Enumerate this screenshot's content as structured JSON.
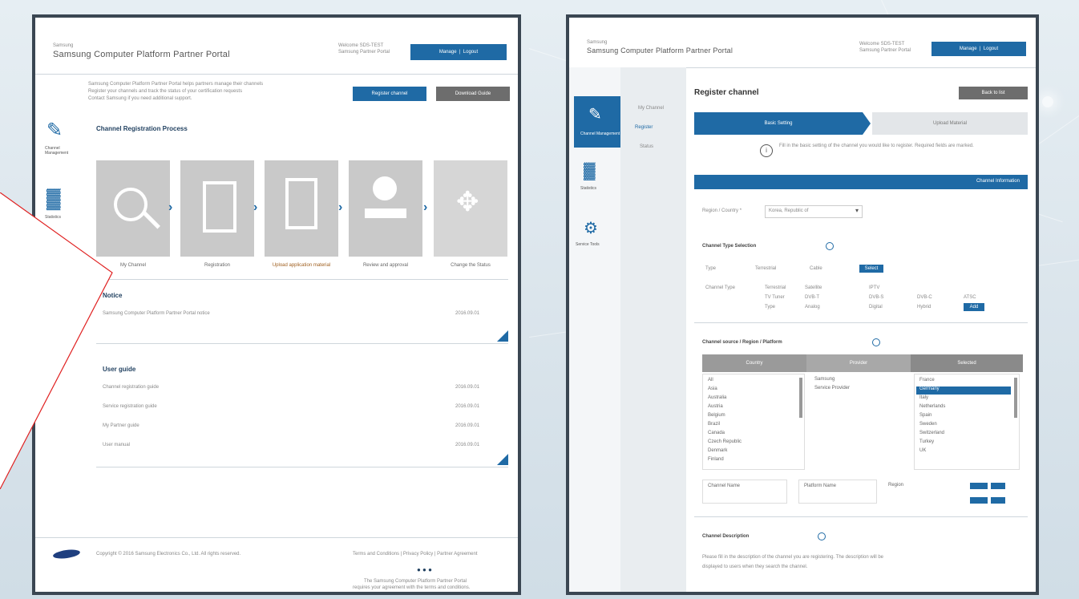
{
  "left_page": {
    "brand_small": "Samsung",
    "title": "Samsung Computer Platform Partner Portal",
    "user_line1": "Welcome SDS-TEST",
    "user_line2": "Samsung Partner Portal",
    "login_label": "Manage",
    "logout_label": "Logout",
    "intro_lines": [
      "Samsung Computer Platform Partner Portal helps partners manage their channels",
      "Register your channels and track the status of your certification requests",
      "Contact Samsung if you need additional support."
    ],
    "register_button": "Register channel",
    "download_button": "Download Guide",
    "side_items": [
      {
        "icon": "register-icon",
        "label": "Channel Management"
      },
      {
        "icon": "chart-icon",
        "label": "Statistics"
      }
    ],
    "process_heading": "Channel Registration Process",
    "process_steps": [
      {
        "icon": "search-icon",
        "label": "My Channel"
      },
      {
        "icon": "document-icon",
        "label": "Registration"
      },
      {
        "icon": "document-edit-icon",
        "label": "Upload application material"
      },
      {
        "icon": "stamp-icon",
        "label": "Review and approval"
      },
      {
        "icon": "move-icon",
        "label": "Change the Status"
      }
    ],
    "notice_heading": "Notice",
    "notice_items": [
      {
        "text": "Samsung Computer Platform Partner Portal notice",
        "date": "2016.09.01"
      }
    ],
    "guide_heading": "User guide",
    "guide_items": [
      {
        "text": "Channel registration guide",
        "date": "2016.09.01"
      },
      {
        "text": "Service registration guide",
        "date": "2016.09.01"
      },
      {
        "text": "My Partner guide",
        "date": "2016.09.01"
      },
      {
        "text": "User manual",
        "date": "2016.09.01"
      }
    ],
    "footer_left": "Copyright © 2016 Samsung Electronics Co., Ltd. All rights reserved.",
    "footer_right": "Terms and Conditions | Privacy Policy | Partner Agreement",
    "footer_bottom1": "The Samsung Computer Platform Partner Portal",
    "footer_bottom2": "requires your agreement with the terms and conditions."
  },
  "right_page": {
    "brand_small": "Samsung",
    "title": "Samsung Computer Platform Partner Portal",
    "user_line1": "Welcome SDS-TEST",
    "user_line2": "Samsung Partner Portal",
    "login_label": "Manage",
    "logout_label": "Logout",
    "side_items": [
      {
        "icon": "register-icon",
        "label": "Channel Management"
      },
      {
        "icon": "chart-icon",
        "label": "Statistics"
      },
      {
        "icon": "tools-icon",
        "label": "Service Tools"
      }
    ],
    "subnav": [
      "My Channel",
      "Register",
      "Status"
    ],
    "page_title": "Register channel",
    "back_button": "Back to list",
    "steps": [
      "Basic Setting",
      "Upload Material"
    ],
    "info_text": "Fill in the basic setting of the channel you would like to register. Required fields are marked.",
    "section_bar_label": "Channel Information",
    "form": {
      "region_label": "Region / Country *",
      "region_value": "Korea, Republic of",
      "channel_type_heading": "Channel Type Selection",
      "tabs": [
        "Type",
        "Terrestrial",
        "Cable",
        "Select"
      ],
      "rows": [
        [
          "Channel Type",
          "Terrestrial",
          "Satellite",
          "IPTV"
        ],
        [
          "TV Tuner",
          "DVB-T",
          "DVB-S",
          "DVB-C",
          "ATSC"
        ],
        [
          "Type",
          "Analog",
          "Digital",
          "Hybrid",
          "Add"
        ]
      ]
    },
    "sources_heading": "Channel source / Region / Platform",
    "source_table_headers": [
      "Country",
      "Provider",
      "Selected"
    ],
    "country_list": [
      "All",
      "Asia",
      "Australia",
      "Austria",
      "Belgium",
      "Brazil",
      "Canada",
      "Czech Republic",
      "Denmark",
      "Finland"
    ],
    "provider_list": [
      "Samsung",
      "Service Provider"
    ],
    "selected_list": [
      "France",
      "Germany",
      "Italy",
      "Netherlands",
      "Spain",
      "Sweden",
      "Switzerland",
      "Turkey",
      "UK"
    ],
    "bottom_fields": [
      "Channel Name",
      "Platform Name",
      "Region"
    ],
    "description_heading": "Channel Description",
    "description_line1": "Please fill in the description of the channel you are registering. The description will be",
    "description_line2": "displayed to users when they search the channel."
  }
}
